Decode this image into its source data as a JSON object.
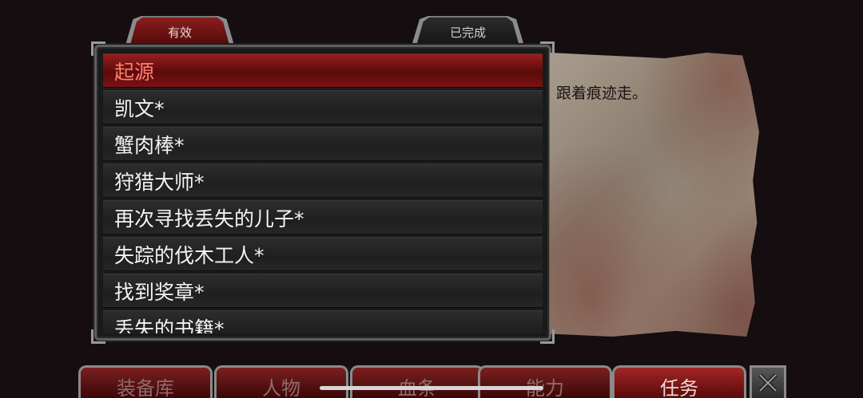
{
  "tabs": [
    {
      "label": "有效",
      "active": true
    },
    {
      "label": "已完成",
      "active": false
    }
  ],
  "quests": [
    {
      "title": "起源",
      "selected": true
    },
    {
      "title": "凯文*",
      "selected": false
    },
    {
      "title": "蟹肉棒*",
      "selected": false
    },
    {
      "title": "狩猎大师*",
      "selected": false
    },
    {
      "title": "再次寻找丢失的儿子*",
      "selected": false
    },
    {
      "title": "失踪的伐木工人*",
      "selected": false
    },
    {
      "title": "找到奖章*",
      "selected": false
    },
    {
      "title": "丢失的书籍*",
      "selected": false
    }
  ],
  "description": "跟着痕迹走。",
  "nav": [
    {
      "label": "装备库",
      "active": false
    },
    {
      "label": "人物",
      "active": false
    },
    {
      "label": "血条",
      "active": false
    },
    {
      "label": "能力",
      "active": false
    },
    {
      "label": "任务",
      "active": true
    }
  ],
  "colors": {
    "selected_row": "#9b1d1d",
    "selected_text": "#ff7e6e",
    "parchment": "#a89c8c",
    "background": "#150d10"
  }
}
